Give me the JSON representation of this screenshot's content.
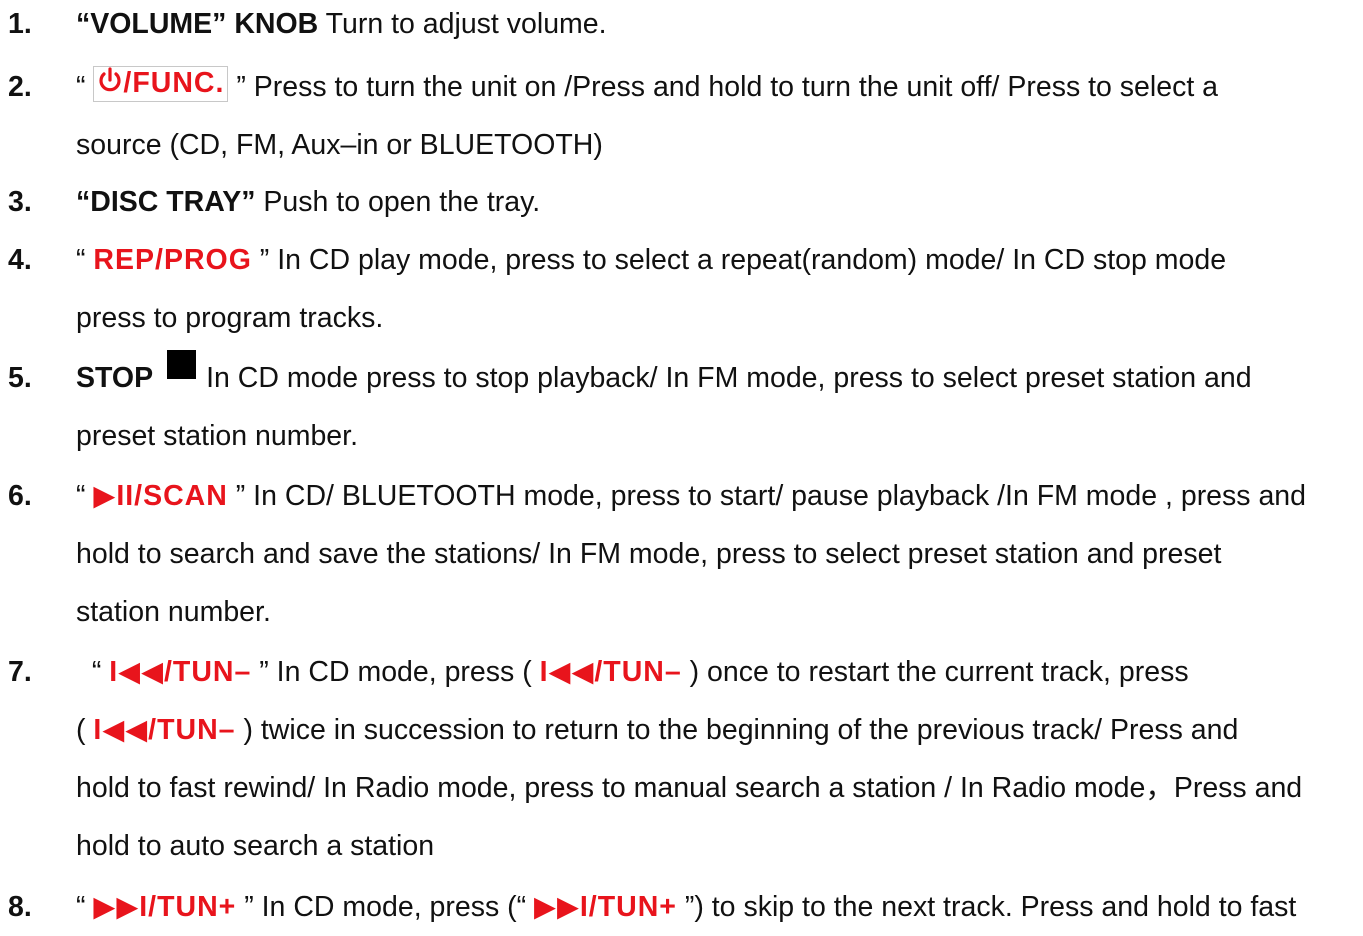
{
  "items": [
    {
      "num": "1.",
      "lines": [
        [
          {
            "t": "“VOLUME” KNOB",
            "s": "b"
          },
          {
            "t": " Turn to adjust volume."
          }
        ]
      ]
    },
    {
      "num": "2.",
      "lines": [
        [
          {
            "t": "“ "
          },
          {
            "t": "power-icon",
            "icon": true
          },
          {
            "t": "/FUNC.",
            "s": "red-box"
          },
          {
            "t": " ” Press to turn the unit on /Press and hold to turn the unit off/ Press to select a"
          }
        ],
        [
          {
            "t": "source (CD, FM, Aux–in or BLUETOOTH)"
          }
        ]
      ]
    },
    {
      "num": "3.",
      "lines": [
        [
          {
            "t": "“DISC TRAY”",
            "s": "b"
          },
          {
            "t": " Push to open the tray."
          }
        ]
      ]
    },
    {
      "num": "4.",
      "lines": [
        [
          {
            "t": "“ "
          },
          {
            "t": "REP/PROG",
            "s": "red"
          },
          {
            "t": " ” In CD play mode, press to select a repeat(random) mode/ In CD stop mode"
          }
        ],
        [
          {
            "t": "press to program tracks."
          }
        ]
      ]
    },
    {
      "num": "5.",
      "lines": [
        [
          {
            "t": "STOP",
            "s": "b"
          },
          {
            "t": "stop-square-icon",
            "icon": true
          },
          {
            "t": "In CD mode press to stop playback/ In FM mode, press to select preset station and"
          }
        ],
        [
          {
            "t": "preset station number."
          }
        ]
      ]
    },
    {
      "num": "6.",
      "lines": [
        [
          {
            "t": "“ "
          },
          {
            "t": "▶II/SCAN",
            "s": "red"
          },
          {
            "t": " ” In CD/ BLUETOOTH mode, press to start/ pause playback /In FM mode , press and"
          }
        ],
        [
          {
            "t": "hold to search and save the stations/ In FM mode, press to select preset station and preset"
          }
        ],
        [
          {
            "t": "station number."
          }
        ]
      ]
    },
    {
      "num": "7.",
      "lines": [
        [
          {
            "t": "  “ "
          },
          {
            "t": "I◀◀/TUN–",
            "s": "red"
          },
          {
            "t": " ” In CD mode, press ( "
          },
          {
            "t": "I◀◀/TUN–",
            "s": "red"
          },
          {
            "t": " ) once to restart the current track, press"
          }
        ],
        [
          {
            "t": "( "
          },
          {
            "t": "I◀◀/TUN–",
            "s": "red"
          },
          {
            "t": " ) twice in succession to return to the beginning of the previous track/ Press and"
          }
        ],
        [
          {
            "t": "hold to fast rewind/ In Radio mode, press to manual search a station / In Radio mode，Press and"
          }
        ],
        [
          {
            "t": "hold to auto search a station"
          }
        ]
      ]
    },
    {
      "num": "8.",
      "lines": [
        [
          {
            "t": "“ "
          },
          {
            "t": "▶▶I/TUN+",
            "s": "red"
          },
          {
            "t": " ” In CD mode, press (“ "
          },
          {
            "t": "▶▶I/TUN+",
            "s": "red"
          },
          {
            "t": " ”) to skip to the next track. Press and hold to fast"
          }
        ]
      ]
    }
  ],
  "colors": {
    "accent_red": "#e8141c",
    "text": "#111111"
  }
}
